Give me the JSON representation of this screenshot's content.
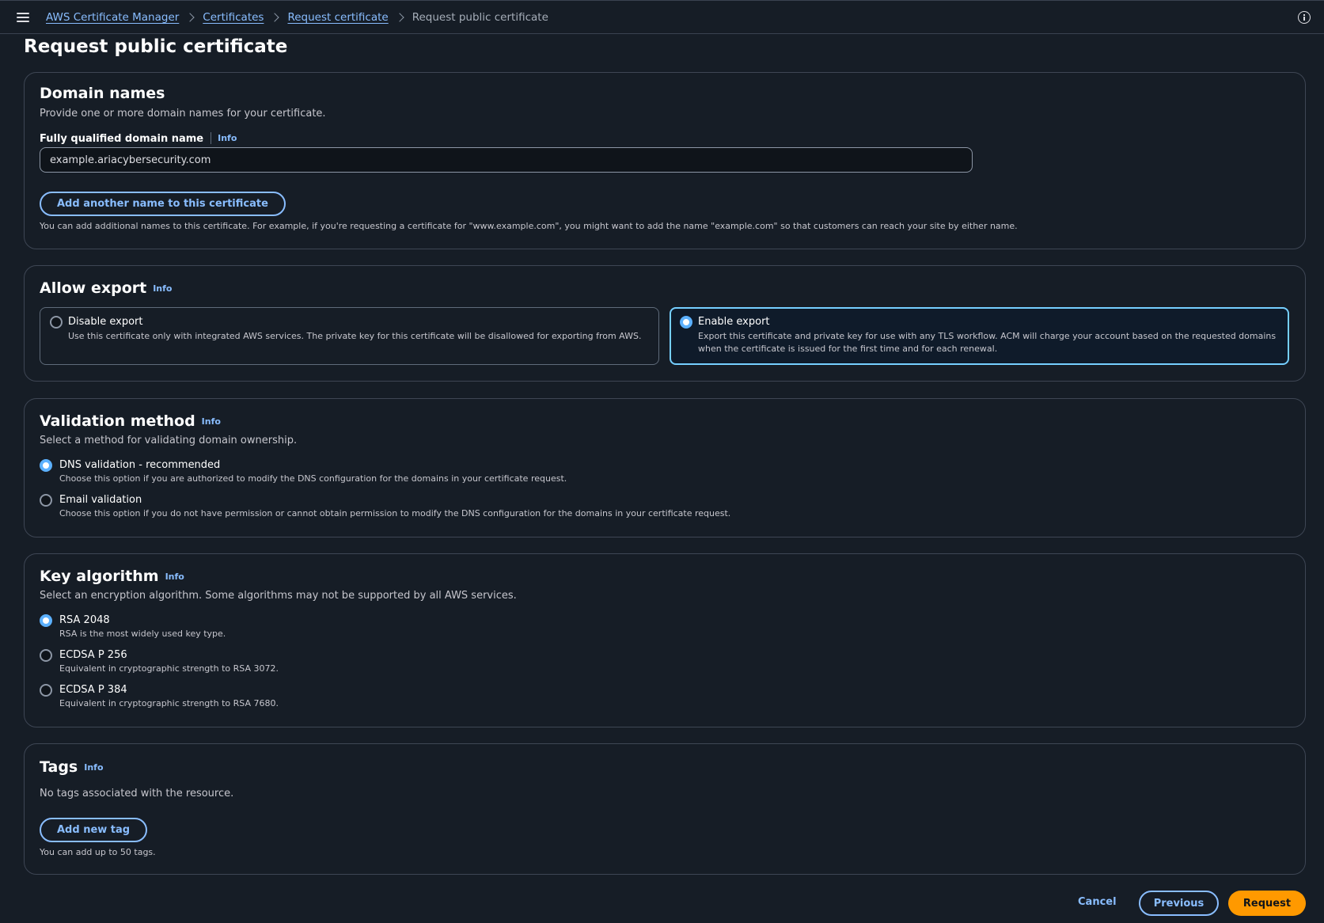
{
  "breadcrumb": {
    "items": [
      "AWS Certificate Manager",
      "Certificates",
      "Request certificate"
    ],
    "current": "Request public certificate"
  },
  "page_title": "Request public certificate",
  "domain_names": {
    "title": "Domain names",
    "description": "Provide one or more domain names for your certificate.",
    "field_label": "Fully qualified domain name",
    "info": "Info",
    "value": "example.ariacybersecurity.com",
    "add_button": "Add another name to this certificate",
    "help": "You can add additional names to this certificate. For example, if you're requesting a certificate for \"www.example.com\", you might want to add the name \"example.com\" so that customers can reach your site by either name."
  },
  "allow_export": {
    "title": "Allow export",
    "info": "Info",
    "options": [
      {
        "label": "Disable export",
        "description": "Use this certificate only with integrated AWS services. The private key for this certificate will be disallowed for exporting from AWS.",
        "selected": false
      },
      {
        "label": "Enable export",
        "description": "Export this certificate and private key for use with any TLS workflow. ACM will charge your account based on the requested domains when the certificate is issued for the first time and for each renewal.",
        "selected": true
      }
    ]
  },
  "validation": {
    "title": "Validation method",
    "info": "Info",
    "description": "Select a method for validating domain ownership.",
    "options": [
      {
        "label": "DNS validation - recommended",
        "description": "Choose this option if you are authorized to modify the DNS configuration for the domains in your certificate request.",
        "selected": true
      },
      {
        "label": "Email validation",
        "description": "Choose this option if you do not have permission or cannot obtain permission to modify the DNS configuration for the domains in your certificate request.",
        "selected": false
      }
    ]
  },
  "key_algorithm": {
    "title": "Key algorithm",
    "info": "Info",
    "description": "Select an encryption algorithm. Some algorithms may not be supported by all AWS services.",
    "options": [
      {
        "label": "RSA 2048",
        "description": "RSA is the most widely used key type.",
        "selected": true
      },
      {
        "label": "ECDSA P 256",
        "description": "Equivalent in cryptographic strength to RSA 3072.",
        "selected": false
      },
      {
        "label": "ECDSA P 384",
        "description": "Equivalent in cryptographic strength to RSA 7680.",
        "selected": false
      }
    ]
  },
  "tags": {
    "title": "Tags",
    "info": "Info",
    "empty": "No tags associated with the resource.",
    "add_button": "Add new tag",
    "help": "You can add up to 50 tags."
  },
  "footer": {
    "cancel": "Cancel",
    "previous": "Previous",
    "request": "Request"
  },
  "colors": {
    "background": "#161d26",
    "link": "#89bdff",
    "primary": "#ff9900",
    "selected_border": "#75cfff"
  }
}
